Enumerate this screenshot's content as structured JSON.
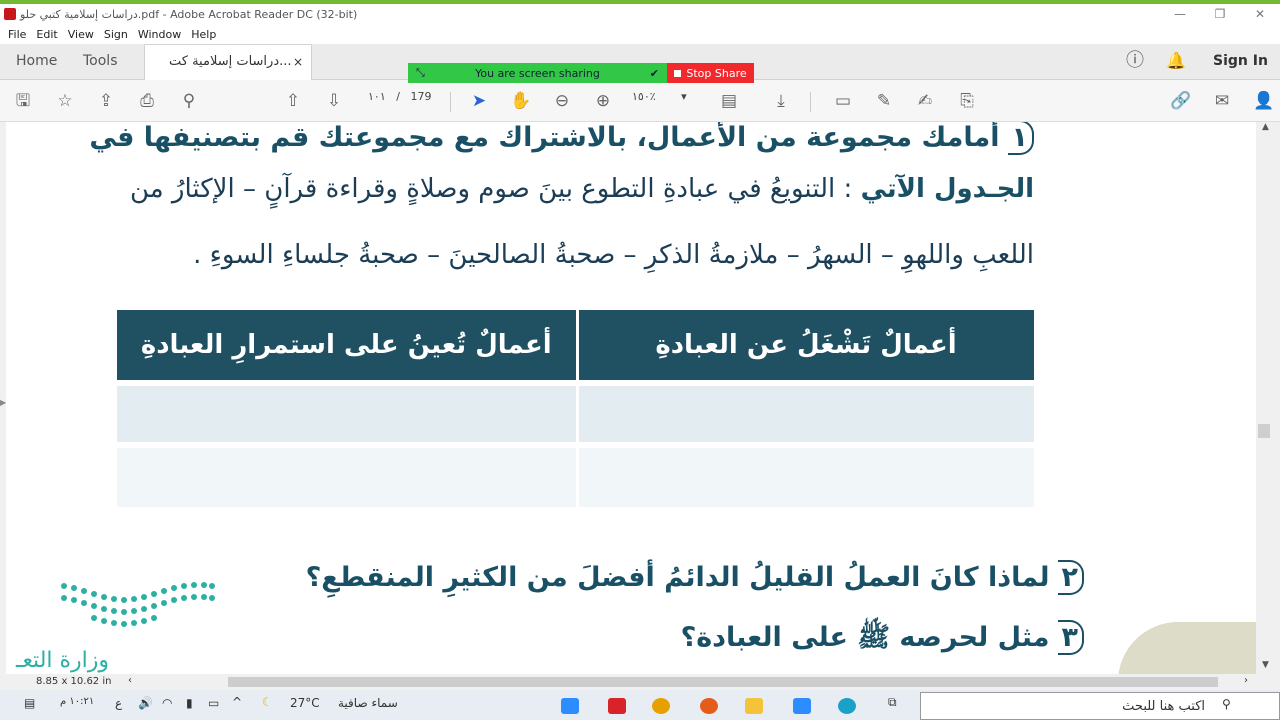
{
  "window": {
    "title": "دراسات إسلامية كتبي حلو.pdf - Adobe Acrobat Reader DC (32-bit)"
  },
  "menu": [
    "File",
    "Edit",
    "View",
    "Sign",
    "Window",
    "Help"
  ],
  "tabs": {
    "home": "Home",
    "tools": "Tools",
    "document": "دراسات إسلامية كت...",
    "close": "×",
    "sign_in": "Sign In"
  },
  "share": {
    "status": "You are screen sharing",
    "stop": "Stop Share"
  },
  "toolbar": {
    "page_current": "١٠١",
    "page_sep": "/",
    "page_total": "179",
    "zoom": "١٥٠٪"
  },
  "document": {
    "q1_num": "١",
    "q1_line1": "أمامك مجموعة من الأعمال، بالاشتراك مع مجموعتك قم بتصنيفها في",
    "q1_line2_bold": "الجـدول الآتي",
    "q1_line2_rest": ": التنويعُ في عبادةِ التطوع بينَ صوم وصلاةٍ وقراءة قرآنٍ – الإكثارُ من",
    "q1_line3": "اللعبِ واللهوِ – السهرُ – ملازمةُ الذكرِ – صحبةُ الصالحينَ – صحبةُ جلساءِ السوءِ .",
    "table_headers": [
      "أعمالٌ تُعينُ على استمرارِ العبادةِ",
      "أعمالٌ تَشْغَلُ عن العبادةِ"
    ],
    "q2_num": "٢",
    "q2": "لماذا كانَ العملُ القليلُ الدائمُ أفضلَ من الكثيرِ المنقطعِ؟",
    "q3_num": "٣",
    "q3": "مثل لحرصه ﷺ على العبادة؟",
    "ministry": "وزارة التعـ"
  },
  "status": {
    "page_size": "8.85 x 10.62 in"
  },
  "taskbar": {
    "search": "اكتب هنا للبحث",
    "weather": "سماء صافية",
    "temp": "27°C",
    "time": "١٠:٢١ م",
    "lang": "ع"
  },
  "colors": {
    "teal_header": "#1f5163",
    "share_green": "#33c748",
    "stop_red": "#f1292c"
  }
}
